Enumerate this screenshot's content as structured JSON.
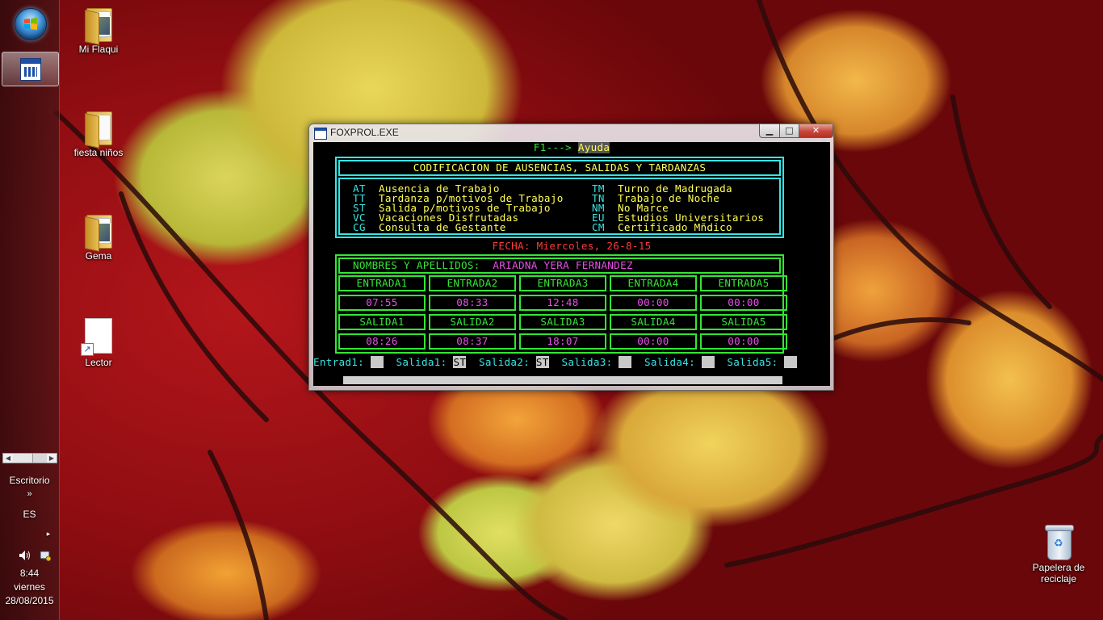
{
  "desktop": {
    "icons": [
      {
        "label": "Mi Flaqui",
        "icon": "folder-icon"
      },
      {
        "label": "fiesta niños",
        "icon": "folder-icon"
      },
      {
        "label": "Gema",
        "icon": "folder-icon"
      },
      {
        "label": "Lector",
        "icon": "shortcut-document-icon"
      }
    ],
    "recycle_bin": {
      "line1": "Papelera de",
      "line2": "reciclaje"
    }
  },
  "taskbar": {
    "toolbar_label": "Escritorio",
    "chevron": "»",
    "language": "ES",
    "expand_arrow": "▸",
    "time": "8:44",
    "day": "viernes",
    "date": "28/08/2015"
  },
  "window": {
    "title": "FOXPROL.EXE",
    "help_prefix": "F1---> ",
    "help_label": "Ayuda",
    "panel_title": "CODIFICACION DE AUSENCIAS, SALIDAS Y TARDANZAS",
    "codes_left": [
      {
        "code": "AT",
        "desc": "Ausencia de Trabajo"
      },
      {
        "code": "TT",
        "desc": "Tardanza p/motivos de Trabajo"
      },
      {
        "code": "ST",
        "desc": "Salida p/motivos de Trabajo"
      },
      {
        "code": "VC",
        "desc": "Vacaciones Disfrutadas"
      },
      {
        "code": "CG",
        "desc": "Consulta de Gestante"
      }
    ],
    "codes_right": [
      {
        "code": "TM",
        "desc": "Turno de Madrugada"
      },
      {
        "code": "TN",
        "desc": "Trabajo de Noche"
      },
      {
        "code": "NM",
        "desc": "No Marce"
      },
      {
        "code": "EU",
        "desc": "Estudios Universitarios"
      },
      {
        "code": "CM",
        "desc": "Certificado Mñdico"
      }
    ],
    "fecha": "FECHA: Miercoles, 26-8-15",
    "name_label": "NOMBRES Y APELLIDOS:",
    "name_value": "ARIADNA YERA FERNANDEZ",
    "entradas": {
      "headers": [
        "ENTRADA1",
        "ENTRADA2",
        "ENTRADA3",
        "ENTRADA4",
        "ENTRADA5"
      ],
      "values": [
        "07:55",
        "08:33",
        "12:48",
        "00:00",
        "00:00"
      ]
    },
    "salidas": {
      "headers": [
        "SALIDA1",
        "SALIDA2",
        "SALIDA3",
        "SALIDA4",
        "SALIDA5"
      ],
      "values": [
        "08:26",
        "08:37",
        "18:07",
        "00:00",
        "00:00"
      ]
    },
    "fields": [
      {
        "label": "Entrad1:",
        "value": "  "
      },
      {
        "label": "Salida1:",
        "value": "ST"
      },
      {
        "label": "Salida2:",
        "value": "ST"
      },
      {
        "label": "Salida3:",
        "value": "  "
      },
      {
        "label": "Salida4:",
        "value": "  "
      },
      {
        "label": "Salida5:",
        "value": "  "
      }
    ]
  },
  "colors": {
    "console_bg": "#000000",
    "cyan": "#36e5e5",
    "green": "#33e633",
    "magenta": "#e64fe6",
    "red": "#ff3a3a",
    "yellow": "#ffff55"
  }
}
